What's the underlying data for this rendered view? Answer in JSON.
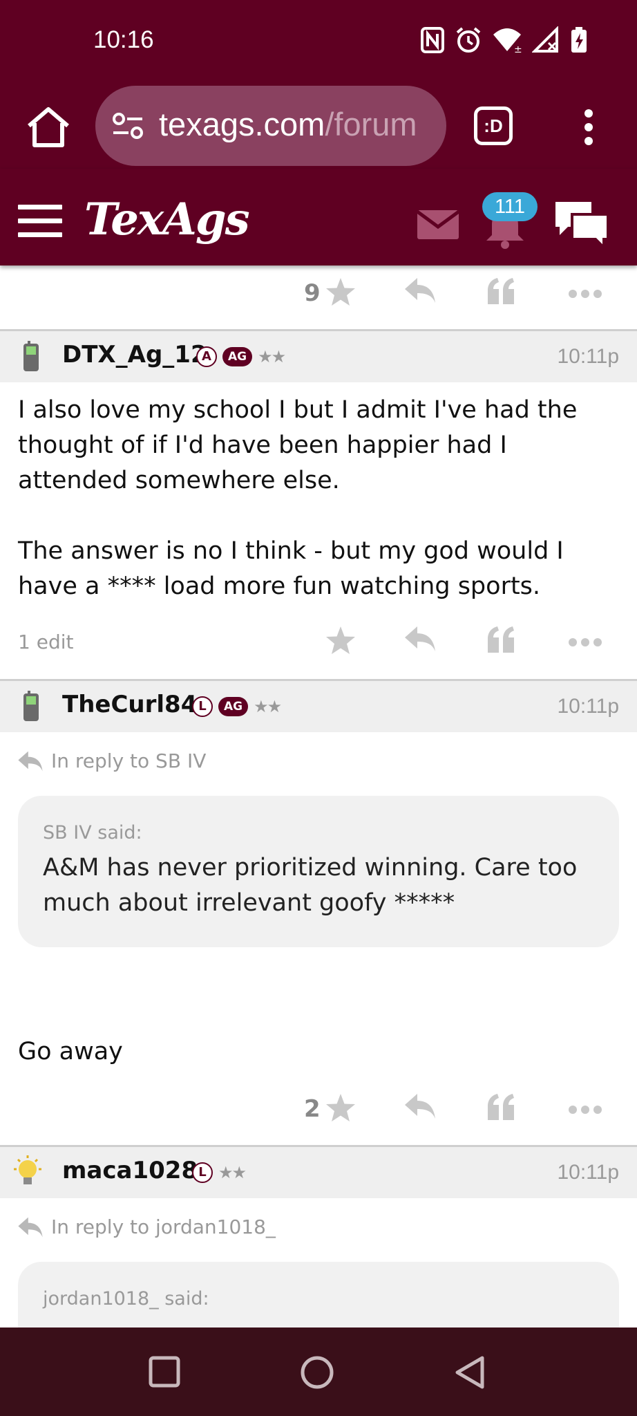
{
  "status": {
    "time": "10:16",
    "icons": [
      "nfc-icon",
      "alarm-icon",
      "wifi-icon",
      "signal-icon",
      "battery-charging-icon"
    ]
  },
  "browser": {
    "url_main": "texags.com",
    "url_rest": "/forum",
    "tab_label": ":D"
  },
  "site": {
    "logo": "TexAgs",
    "notification_count": "111"
  },
  "posts": [
    {
      "type": "partial",
      "star_count": "9"
    },
    {
      "username": "DTX_Ag_12",
      "badge_letter": "A",
      "badge_ag": "AG",
      "stars": "★★",
      "time": "10:11p",
      "paragraphs": [
        "I also love my school I but I admit I've had the thought of if I'd have been happier had I attended somewhere else.",
        "The answer is no I think - but my god would I have a **** load more fun watching sports."
      ],
      "edit_note": "1 edit",
      "star_count": ""
    },
    {
      "username": "TheCurl84",
      "badge_letter": "L",
      "badge_ag": "AG",
      "stars": "★★",
      "time": "10:11p",
      "reply_to": "In reply to SB IV",
      "quote_author": "SB IV said:",
      "quote_text": "A&M has never prioritized winning. Care too much about irrelevant goofy *****",
      "body": "Go away",
      "star_count": "2"
    },
    {
      "username": "maca1028",
      "badge_letter": "L",
      "stars": "★★",
      "time": "10:11p",
      "reply_to": "In reply to jordan1018_",
      "quote_author": "jordan1018_ said:"
    }
  ],
  "colors": {
    "maroon": "#5f0022",
    "nav_bar": "#3a0f19",
    "badge_blue": "#3aa8d8"
  }
}
